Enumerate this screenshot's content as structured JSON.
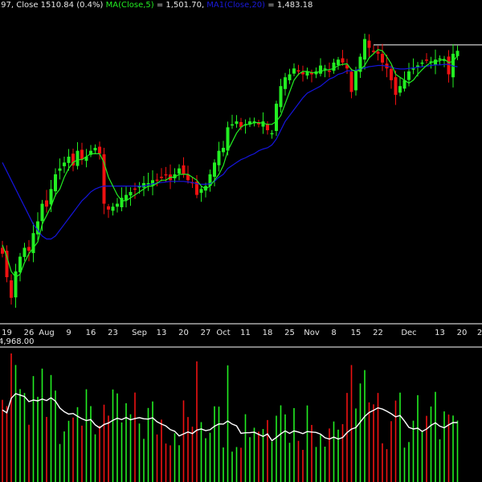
{
  "header": {
    "ohlc_fragment": ".97, Close 1510.84 (0.4%)",
    "ma5_label": "MA(Close,5)",
    "ma5_value": " = 1,501.70, ",
    "ma20_label": "MA1(Close,20)",
    "ma20_value": " = 1,483.18"
  },
  "volume_label": "4,968.00",
  "colors": {
    "up": "#22ee22",
    "down": "#ee1111",
    "ma5": "#22ee22",
    "ma20": "#1515dd",
    "axis": "#ffffff",
    "text": "#e6e6e6",
    "volume_ma": "#ffffff"
  },
  "chart_data": {
    "type": "candlestick",
    "y_range_candles": [
      1050,
      1580
    ],
    "x_tick_labels": [
      {
        "label": "19",
        "index": 1
      },
      {
        "label": "26",
        "index": 6
      },
      {
        "label": "Aug",
        "index": 10
      },
      {
        "label": "9",
        "index": 15
      },
      {
        "label": "16",
        "index": 20
      },
      {
        "label": "23",
        "index": 25
      },
      {
        "label": "Sep",
        "index": 31
      },
      {
        "label": "13",
        "index": 36
      },
      {
        "label": "20",
        "index": 41
      },
      {
        "label": "27",
        "index": 46
      },
      {
        "label": "Oct",
        "index": 50
      },
      {
        "label": "11",
        "index": 55
      },
      {
        "label": "18",
        "index": 60
      },
      {
        "label": "25",
        "index": 65
      },
      {
        "label": "Nov",
        "index": 70
      },
      {
        "label": "8",
        "index": 75
      },
      {
        "label": "15",
        "index": 80
      },
      {
        "label": "22",
        "index": 85
      },
      {
        "label": "Dec",
        "index": 92
      },
      {
        "label": "13",
        "index": 99
      },
      {
        "label": "20",
        "index": 104
      },
      {
        "label": "2",
        "index": 108
      }
    ],
    "close": [
      1165,
      1125,
      1090,
      1135,
      1160,
      1175,
      1170,
      1200,
      1220,
      1250,
      1245,
      1275,
      1300,
      1310,
      1320,
      1330,
      1315,
      1340,
      1325,
      1330,
      1340,
      1345,
      1335,
      1250,
      1240,
      1245,
      1250,
      1260,
      1265,
      1270,
      1275,
      1280,
      1285,
      1285,
      1290,
      1290,
      1295,
      1300,
      1290,
      1300,
      1310,
      1300,
      1290,
      1285,
      1265,
      1275,
      1280,
      1300,
      1320,
      1340,
      1345,
      1380,
      1385,
      1390,
      1380,
      1385,
      1390,
      1390,
      1385,
      1390,
      1375,
      1370,
      1420,
      1450,
      1465,
      1470,
      1480,
      1475,
      1470,
      1475,
      1470,
      1475,
      1485,
      1480,
      1475,
      1490,
      1495,
      1490,
      1480,
      1440,
      1475,
      1500,
      1530,
      1515,
      1510,
      1505,
      1490,
      1480,
      1460,
      1435,
      1450,
      1460,
      1475,
      1480,
      1485,
      1490,
      1495,
      1492,
      1495,
      1497,
      1495,
      1470,
      1505,
      1510
    ],
    "ma5": [
      1180,
      1160,
      1135,
      1125,
      1130,
      1150,
      1165,
      1175,
      1185,
      1215,
      1230,
      1245,
      1265,
      1275,
      1295,
      1310,
      1320,
      1325,
      1325,
      1330,
      1335,
      1335,
      1335,
      1320,
      1295,
      1280,
      1265,
      1255,
      1255,
      1260,
      1265,
      1270,
      1275,
      1280,
      1280,
      1285,
      1290,
      1290,
      1295,
      1295,
      1300,
      1300,
      1300,
      1295,
      1290,
      1280,
      1275,
      1280,
      1290,
      1300,
      1315,
      1340,
      1355,
      1370,
      1380,
      1385,
      1385,
      1388,
      1388,
      1387,
      1385,
      1385,
      1390,
      1400,
      1420,
      1440,
      1460,
      1470,
      1475,
      1475,
      1473,
      1473,
      1475,
      1477,
      1478,
      1480,
      1485,
      1487,
      1488,
      1478,
      1475,
      1478,
      1485,
      1498,
      1505,
      1512,
      1510,
      1500,
      1488,
      1470,
      1465,
      1460,
      1455,
      1460,
      1470,
      1478,
      1485,
      1490,
      1492,
      1493,
      1496,
      1490,
      1492,
      1502
    ],
    "ma20": [
      1320,
      1305,
      1290,
      1275,
      1260,
      1245,
      1230,
      1215,
      1205,
      1195,
      1190,
      1190,
      1195,
      1205,
      1215,
      1225,
      1235,
      1245,
      1255,
      1262,
      1270,
      1275,
      1278,
      1280,
      1280,
      1280,
      1280,
      1280,
      1280,
      1280,
      1280,
      1280,
      1280,
      1282,
      1284,
      1285,
      1286,
      1287,
      1288,
      1288,
      1288,
      1288,
      1287,
      1286,
      1284,
      1283,
      1283,
      1284,
      1288,
      1295,
      1300,
      1310,
      1315,
      1320,
      1325,
      1328,
      1332,
      1335,
      1340,
      1343,
      1345,
      1350,
      1360,
      1375,
      1390,
      1400,
      1410,
      1420,
      1430,
      1438,
      1442,
      1446,
      1450,
      1456,
      1462,
      1465,
      1470,
      1472,
      1476,
      1476,
      1477,
      1479,
      1481,
      1483,
      1484,
      1485,
      1485,
      1484,
      1482,
      1480,
      1479,
      1479,
      1480,
      1481,
      1482,
      1483,
      1484,
      1485,
      1486,
      1486,
      1487,
      1487,
      1484,
      1483
    ],
    "resistance_line": {
      "value": 1520,
      "from_index": 84
    }
  }
}
